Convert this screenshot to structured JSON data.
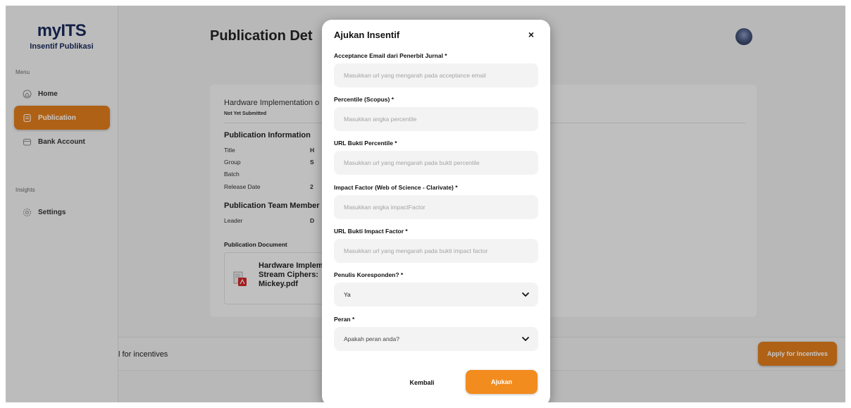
{
  "sidebar": {
    "brand": "myITS",
    "subtitle": "Insentif Publikasi",
    "menu_label": "Menu",
    "insights_label": "Insights",
    "items": [
      {
        "label": "Home"
      },
      {
        "label": "Publication"
      },
      {
        "label": "Bank Account"
      },
      {
        "label": "Settings"
      }
    ]
  },
  "main": {
    "title": "Publication Det",
    "publication_title": "Hardware Implementation o",
    "status": "Not Yet Submitted",
    "info_heading": "Publication Information",
    "info": [
      {
        "label": "Title",
        "value": "H"
      },
      {
        "label": "Group",
        "value": "S"
      },
      {
        "label": "Batch",
        "value": ""
      },
      {
        "label": "Release Date",
        "value": "2"
      }
    ],
    "team_heading": "Publication Team Member",
    "team": [
      {
        "label": "Leader",
        "value": "D"
      }
    ],
    "document_heading": "Publication Document",
    "document_name": "Hardware Implem\nStream Ciphers: \nMickey.pdf",
    "bottom_text": "l for incentives",
    "apply_label": "Apply for Incentives"
  },
  "modal": {
    "title": "Ajukan Insentif",
    "close": "×",
    "fields": [
      {
        "label": "Acceptance Email dari Penerbit Jurnal *",
        "placeholder": "Masukkan url yang mengarah pada acceptance email"
      },
      {
        "label": "Percentile (Scopus) *",
        "placeholder": "Masukkan angka percentile"
      },
      {
        "label": "URL Bukti Percentile *",
        "placeholder": "Masukkan url yang mengarah pada bukti percentile"
      },
      {
        "label": "Impact Factor (Web of Science - Clarivate) *",
        "placeholder": "Masukkan angka impactFactor"
      },
      {
        "label": "URL Bukti Impact Factor *",
        "placeholder": "Masukkan url yang mengarah pada bukti impact factor"
      }
    ],
    "correspondent": {
      "label": "Penulis Koresponden? *",
      "value": "Ya"
    },
    "role": {
      "label": "Peran *",
      "value": "Apakah peran anda?"
    },
    "back_label": "Kembali",
    "submit_label": "Ajukan"
  },
  "colors": {
    "accent": "#e07d1c",
    "submit": "#f28c1e",
    "brand_text": "#1a2a5a"
  },
  "icons": [
    "home-icon",
    "document-icon",
    "wallet-icon",
    "gear-icon",
    "pdf-file-icon",
    "close-icon",
    "chevron-down-icon"
  ]
}
